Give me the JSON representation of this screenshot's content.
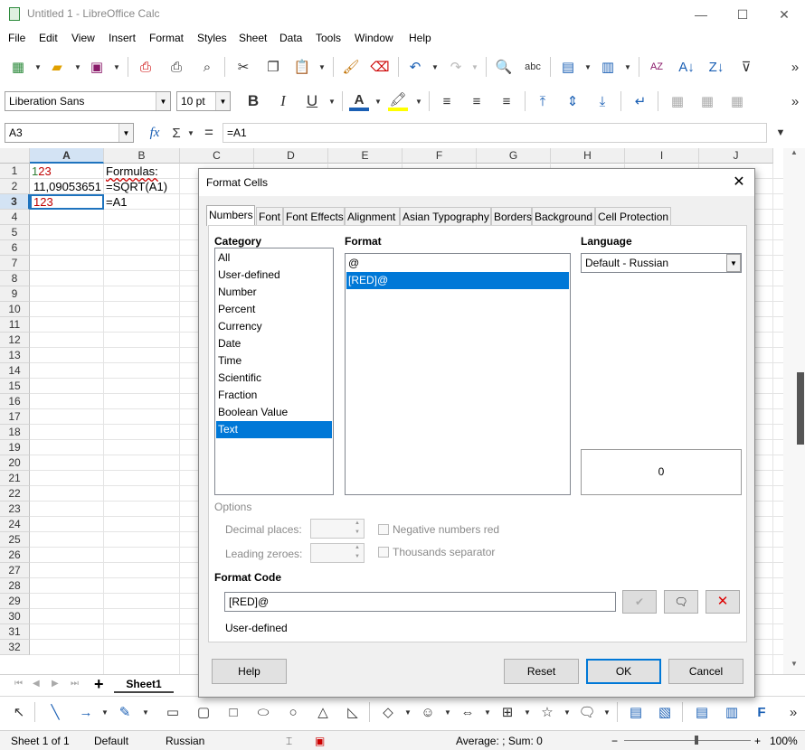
{
  "window": {
    "title": "Untitled 1 - LibreOffice Calc",
    "minimize": "—",
    "maximize": "☐",
    "close": "✕"
  },
  "menu": [
    "File",
    "Edit",
    "View",
    "Insert",
    "Format",
    "Styles",
    "Sheet",
    "Data",
    "Tools",
    "Window",
    "Help"
  ],
  "formatting": {
    "font_name": "Liberation Sans",
    "font_size": "10 pt",
    "bold": "B",
    "italic": "I",
    "underline": "U"
  },
  "formula_bar": {
    "name_box": "A3",
    "fx": "fx",
    "sum": "Σ",
    "equals": "=",
    "content": "=A1"
  },
  "columns": [
    "A",
    "B",
    "C",
    "D",
    "E",
    "F",
    "G",
    "H",
    "I",
    "J"
  ],
  "rows": [
    "1",
    "2",
    "3",
    "4",
    "5",
    "6",
    "7",
    "8",
    "9",
    "10",
    "11",
    "12",
    "13",
    "14",
    "15",
    "16",
    "17",
    "18",
    "19",
    "20",
    "21",
    "22",
    "23",
    "24",
    "25",
    "26",
    "27",
    "28",
    "29",
    "30",
    "31",
    "32"
  ],
  "cells": {
    "a1": "123",
    "b1": "Formulas:",
    "a2": "11,09053651",
    "b2": "=SQRT(A1)",
    "a3": "123",
    "b3": "=A1"
  },
  "sheet_tab": "Sheet1",
  "status": {
    "sheet": "Sheet 1 of 1",
    "style": "Default",
    "language": "Russian",
    "summary": "Average: ; Sum: 0",
    "zoom": "100%"
  },
  "dialog": {
    "title": "Format Cells",
    "tabs": [
      "Numbers",
      "Font",
      "Font Effects",
      "Alignment",
      "Asian Typography",
      "Borders",
      "Background",
      "Cell Protection"
    ],
    "category_label": "Category",
    "categories": [
      "All",
      "User-defined",
      "Number",
      "Percent",
      "Currency",
      "Date",
      "Time",
      "Scientific",
      "Fraction",
      "Boolean Value",
      "Text"
    ],
    "selected_category": "Text",
    "format_label": "Format",
    "formats": [
      "@",
      "[RED]@"
    ],
    "selected_format": "[RED]@",
    "language_label": "Language",
    "language_value": "Default - Russian",
    "preview": "0",
    "options_label": "Options",
    "decimal_places_label": "Decimal places:",
    "leading_zeroes_label": "Leading zeroes:",
    "negative_red_label": "Negative numbers red",
    "thousands_label": "Thousands separator",
    "format_code_label": "Format Code",
    "format_code_value": "[RED]@",
    "format_code_desc": "User-defined",
    "buttons": {
      "help": "Help",
      "reset": "Reset",
      "ok": "OK",
      "cancel": "Cancel"
    }
  },
  "colors": {
    "accent": "#0078d7",
    "red_text": "#c00000",
    "selected_cell_border": "#1e73be"
  }
}
